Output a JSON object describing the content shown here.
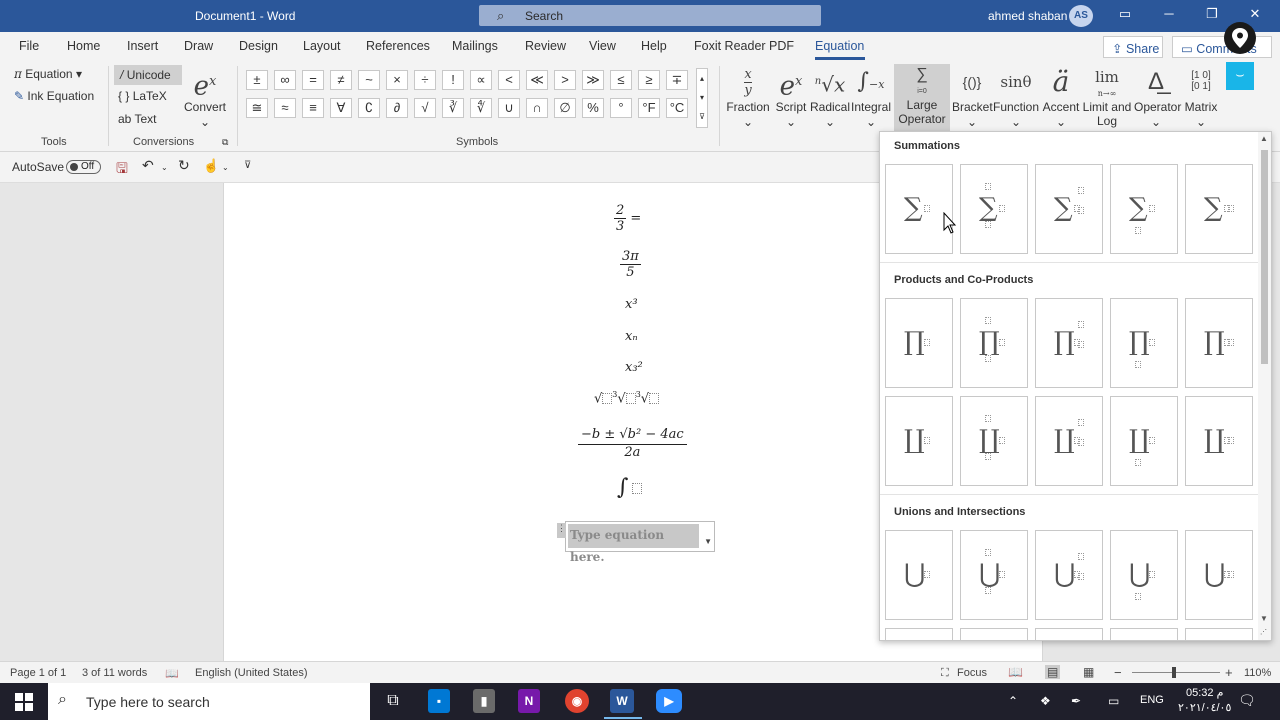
{
  "titlebar": {
    "doc_title": "Document1  -  Word",
    "search_placeholder": "Search",
    "user_name": "ahmed shaban",
    "avatar_initials": "AS"
  },
  "tabs": [
    {
      "label": "File"
    },
    {
      "label": "Home"
    },
    {
      "label": "Insert"
    },
    {
      "label": "Draw"
    },
    {
      "label": "Design"
    },
    {
      "label": "Layout"
    },
    {
      "label": "References"
    },
    {
      "label": "Mailings"
    },
    {
      "label": "Review"
    },
    {
      "label": "View"
    },
    {
      "label": "Help"
    },
    {
      "label": "Foxit Reader PDF"
    },
    {
      "label": "Equation"
    }
  ],
  "share_label": "Share",
  "comments_label": "Comments",
  "ribbon": {
    "tools": {
      "equation": "Equation",
      "ink_equation": "Ink Equation",
      "group_label": "Tools"
    },
    "conversions": {
      "unicode": "Unicode",
      "latex": "LaTeX",
      "text": "Text",
      "convert": "Convert",
      "group_label": "Conversions"
    },
    "symbols_label": "Symbols",
    "symbols_row1": [
      "±",
      "∞",
      "=",
      "≠",
      "~",
      "×",
      "÷",
      "!",
      "∝",
      "<",
      "≪",
      ">",
      "≫",
      "≤",
      "≥",
      "∓"
    ],
    "symbols_row2": [
      "≅",
      "≈",
      "≡",
      "∀",
      "∁",
      "∂",
      "√",
      "∛",
      "∜",
      "∪",
      "∩",
      "∅",
      "%",
      "°",
      "°F",
      "°C"
    ],
    "structures": [
      {
        "label": "Fraction",
        "glyph": "x/y"
      },
      {
        "label": "Script",
        "glyph": "eˣ"
      },
      {
        "label": "Radical",
        "glyph": "ⁿ√x"
      },
      {
        "label": "Integral",
        "glyph": "∫"
      },
      {
        "label": "Large Operator",
        "glyph": "Σ"
      },
      {
        "label": "Bracket",
        "glyph": "{()}"
      },
      {
        "label": "Function",
        "glyph": "sinθ"
      },
      {
        "label": "Accent",
        "glyph": "ä"
      },
      {
        "label": "Limit and Log",
        "glyph": "lim"
      },
      {
        "label": "Operator",
        "glyph": "Δ"
      },
      {
        "label": "Matrix",
        "glyph": "[10 01]"
      }
    ]
  },
  "qat": {
    "autosave": "AutoSave",
    "toggle": "Off"
  },
  "document": {
    "eq1_num": "2",
    "eq1_den": "3",
    "eq1_tail": "=",
    "eq2_num": "3π",
    "eq2_den": "5",
    "eq3": "x³",
    "eq4": "xₙ",
    "eq5": "x₃²",
    "eq7_num": "−b ± √b² − 4ac",
    "eq7_den": "2a",
    "type_here": "Type equation here."
  },
  "gallery": {
    "sections": [
      {
        "title": "Summations",
        "op": "∑"
      },
      {
        "title": "Products and Co-Products",
        "op": "∏"
      },
      {
        "title": "Unions and Intersections",
        "op": "⋃"
      }
    ]
  },
  "status": {
    "page": "Page 1 of 1",
    "words": "3 of 11 words",
    "language": "English (United States)",
    "focus": "Focus",
    "zoom": "110%"
  },
  "taskbar": {
    "search_placeholder": "Type here to search",
    "lang": "ENG",
    "time": "05:32 م",
    "date": "٢٠٢١/٠٤/٠٥"
  }
}
